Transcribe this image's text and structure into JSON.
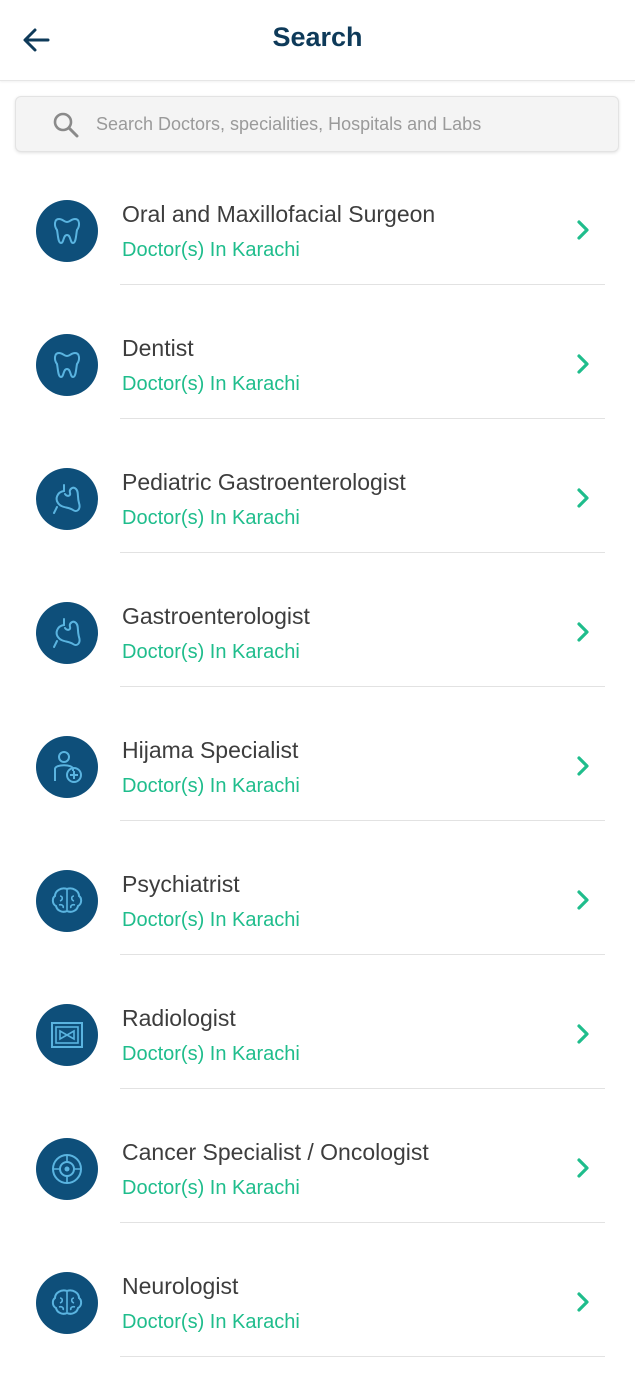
{
  "header": {
    "title": "Search",
    "back_icon": "arrow-left-icon"
  },
  "search": {
    "placeholder": "Search Doctors, specialities, Hospitals and Labs",
    "icon": "search-icon"
  },
  "colors": {
    "title": "#0e3a59",
    "accent": "#1fbd8c",
    "avatar_bg": "#0e4f7a",
    "icon_stroke": "#5ab4e0"
  },
  "items": [
    {
      "name": "Oral and Maxillofacial Surgeon",
      "subtitle": "Doctor(s) In Karachi",
      "icon": "tooth-icon"
    },
    {
      "name": "Dentist",
      "subtitle": "Doctor(s) In Karachi",
      "icon": "tooth-icon"
    },
    {
      "name": "Pediatric Gastroenterologist",
      "subtitle": "Doctor(s) In Karachi",
      "icon": "stomach-icon"
    },
    {
      "name": "Gastroenterologist",
      "subtitle": "Doctor(s) In Karachi",
      "icon": "stomach-icon"
    },
    {
      "name": "Hijama Specialist",
      "subtitle": "Doctor(s) In Karachi",
      "icon": "person-medical-icon"
    },
    {
      "name": "Psychiatrist",
      "subtitle": "Doctor(s) In Karachi",
      "icon": "brain-icon"
    },
    {
      "name": "Radiologist",
      "subtitle": "Doctor(s) In Karachi",
      "icon": "xray-icon"
    },
    {
      "name": "Cancer Specialist / Oncologist",
      "subtitle": "Doctor(s) In Karachi",
      "icon": "cell-icon"
    },
    {
      "name": "Neurologist",
      "subtitle": "Doctor(s) In Karachi",
      "icon": "brain-icon"
    }
  ]
}
